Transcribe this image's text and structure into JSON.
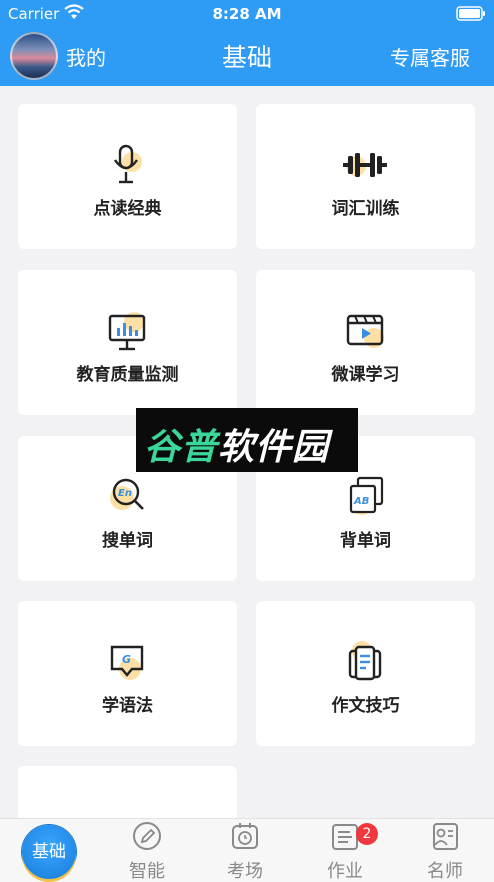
{
  "status_bar": {
    "carrier": "Carrier",
    "time": "8:28 AM"
  },
  "nav": {
    "me_label": "我的",
    "title": "基础",
    "service_label": "专属客服"
  },
  "cards": [
    {
      "label": "点读经典",
      "icon": "microphone-icon"
    },
    {
      "label": "词汇训练",
      "icon": "dumbbell-icon"
    },
    {
      "label": "教育质量监测",
      "icon": "chart-board-icon"
    },
    {
      "label": "微课学习",
      "icon": "video-player-icon"
    },
    {
      "label": "搜单词",
      "icon": "search-en-icon"
    },
    {
      "label": "背单词",
      "icon": "ab-cards-icon"
    },
    {
      "label": "学语法",
      "icon": "grammar-chat-icon"
    },
    {
      "label": "作文技巧",
      "icon": "document-icon"
    },
    {
      "label": "",
      "icon": "partial-card-icon"
    }
  ],
  "watermark": {
    "part1": "谷普",
    "part2": "软件园"
  },
  "tabbar": {
    "home": "基础",
    "tabs": [
      {
        "label": "智能",
        "icon": "pen-icon"
      },
      {
        "label": "考场",
        "icon": "clock-icon"
      },
      {
        "label": "作业",
        "icon": "homework-icon",
        "badge": "2"
      },
      {
        "label": "名师",
        "icon": "teacher-icon"
      }
    ]
  },
  "colors": {
    "primary": "#2e9bf5",
    "accent_yellow": "#fde0a6",
    "badge_red": "#f0393f"
  }
}
